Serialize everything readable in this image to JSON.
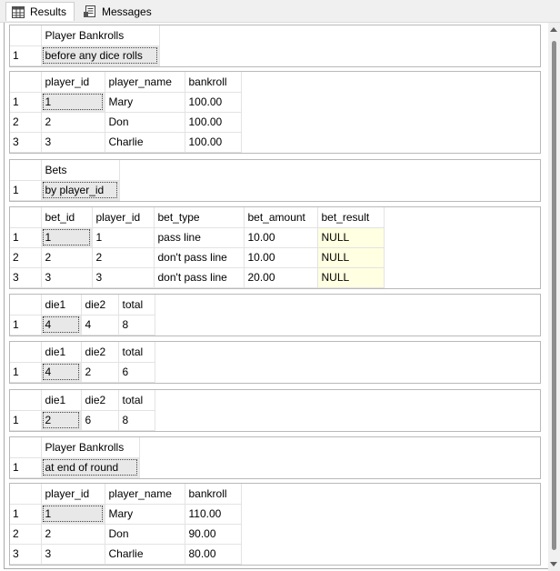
{
  "tabs": [
    {
      "label": "Results",
      "icon": "grid-icon"
    },
    {
      "label": "Messages",
      "icon": "messages-icon"
    }
  ],
  "grids": [
    {
      "columns": [
        "Player Bankrolls"
      ],
      "rows": [
        {
          "n": "1",
          "cells": [
            "before any dice rolls"
          ]
        }
      ]
    },
    {
      "columns": [
        "player_id",
        "player_name",
        "bankroll"
      ],
      "rows": [
        {
          "n": "1",
          "cells": [
            "1",
            "Mary",
            "100.00"
          ]
        },
        {
          "n": "2",
          "cells": [
            "2",
            "Don",
            "100.00"
          ]
        },
        {
          "n": "3",
          "cells": [
            "3",
            "Charlie",
            "100.00"
          ]
        }
      ]
    },
    {
      "columns": [
        "Bets"
      ],
      "rows": [
        {
          "n": "1",
          "cells": [
            "by player_id"
          ]
        }
      ]
    },
    {
      "columns": [
        "bet_id",
        "player_id",
        "bet_type",
        "bet_amount",
        "bet_result"
      ],
      "rows": [
        {
          "n": "1",
          "cells": [
            "1",
            "1",
            "pass line",
            "10.00",
            "NULL"
          ]
        },
        {
          "n": "2",
          "cells": [
            "2",
            "2",
            "don't pass line",
            "10.00",
            "NULL"
          ]
        },
        {
          "n": "3",
          "cells": [
            "3",
            "3",
            "don't pass line",
            "20.00",
            "NULL"
          ]
        }
      ]
    },
    {
      "columns": [
        "die1",
        "die2",
        "total"
      ],
      "rows": [
        {
          "n": "1",
          "cells": [
            "4",
            "4",
            "8"
          ]
        }
      ]
    },
    {
      "columns": [
        "die1",
        "die2",
        "total"
      ],
      "rows": [
        {
          "n": "1",
          "cells": [
            "4",
            "2",
            "6"
          ]
        }
      ]
    },
    {
      "columns": [
        "die1",
        "die2",
        "total"
      ],
      "rows": [
        {
          "n": "1",
          "cells": [
            "2",
            "6",
            "8"
          ]
        }
      ]
    },
    {
      "columns": [
        "Player Bankrolls"
      ],
      "rows": [
        {
          "n": "1",
          "cells": [
            "at end of round"
          ]
        }
      ]
    },
    {
      "columns": [
        "player_id",
        "player_name",
        "bankroll"
      ],
      "rows": [
        {
          "n": "1",
          "cells": [
            "1",
            "Mary",
            "110.00"
          ]
        },
        {
          "n": "2",
          "cells": [
            "2",
            "Don",
            "90.00"
          ]
        },
        {
          "n": "3",
          "cells": [
            "3",
            "Charlie",
            "80.00"
          ]
        }
      ]
    }
  ]
}
